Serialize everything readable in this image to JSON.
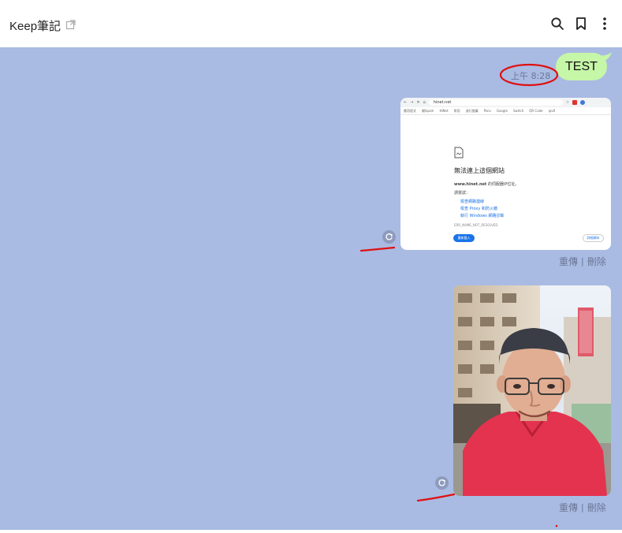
{
  "header": {
    "title": "Keep筆記",
    "icons": [
      "external-link-icon",
      "search-icon",
      "bookmark-icon",
      "more-vertical-icon"
    ]
  },
  "messages": {
    "text_message": {
      "text": "TEST",
      "time": "上午 8:28"
    },
    "screenshot_message": {
      "browser": {
        "url": "hinet.net",
        "bookmarks": [
          "應用程式",
          "開Spam",
          "HiNet",
          "常用",
          "流行推薦",
          "Pixiv",
          "Google",
          "Switch",
          "QR Code",
          "ipv6"
        ],
        "error_title": "無法連上這個網站",
        "error_host": "www.hinet.net",
        "error_message": "的伺服器IP位址。",
        "try_label": "請嘗試：",
        "suggestions": [
          "檢查網路連線",
          "檢查 Proxy 和防火牆",
          "執行 Windows 網路診斷"
        ],
        "error_code": "ERR_NAME_NOT_RESOLVED",
        "reload_label": "重新載入",
        "details_label": "詳細資料"
      }
    },
    "actions": {
      "resend": "重傳",
      "separator": "|",
      "delete": "刪除"
    }
  },
  "colors": {
    "chat_background": "#a9bbe3",
    "bubble": "#c6f6a7",
    "annotation_red": "#e01010",
    "link_blue": "#1a73e8"
  }
}
